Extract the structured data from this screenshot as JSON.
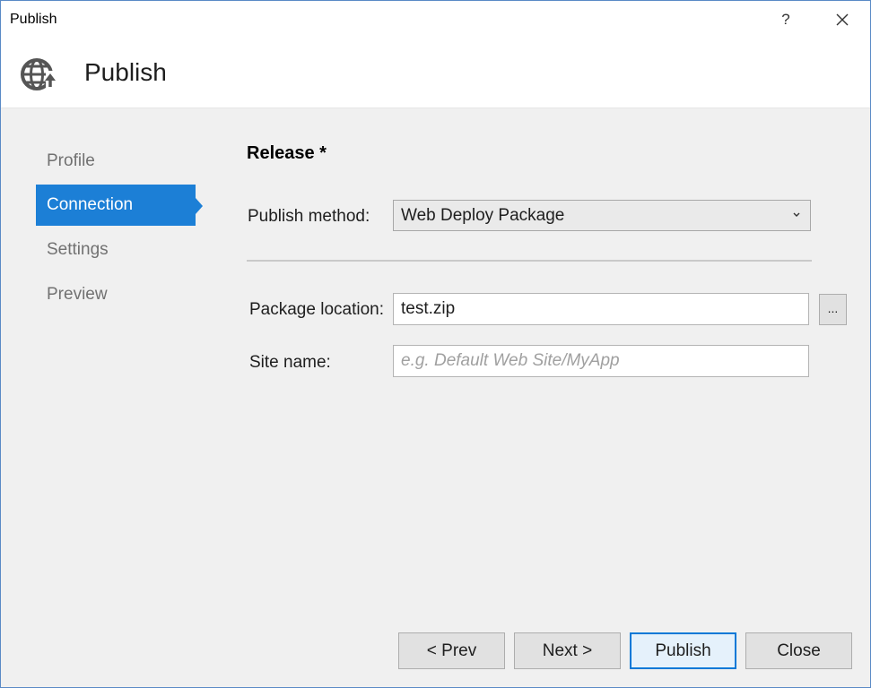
{
  "window": {
    "title": "Publish",
    "help_label": "?"
  },
  "header": {
    "heading": "Publish",
    "logo_icon": "globe-publish-icon"
  },
  "nav": {
    "items": [
      {
        "label": "Profile",
        "active": false
      },
      {
        "label": "Connection",
        "active": true
      },
      {
        "label": "Settings",
        "active": false
      },
      {
        "label": "Preview",
        "active": false
      }
    ]
  },
  "main": {
    "section_title": "Release *",
    "publish_method": {
      "label": "Publish method:",
      "value": "Web Deploy Package"
    },
    "package_location": {
      "label": "Package location:",
      "value": "test.zip",
      "browse_label": "..."
    },
    "site_name": {
      "label": "Site name:",
      "value": "",
      "placeholder": "e.g. Default Web Site/MyApp"
    }
  },
  "buttons": {
    "prev": "< Prev",
    "next": "Next >",
    "publish": "Publish",
    "close": "Close"
  },
  "colors": {
    "accent": "#1c7fd6",
    "primary_button_border": "#0078d7",
    "dialog_background": "#f0f0f0"
  }
}
